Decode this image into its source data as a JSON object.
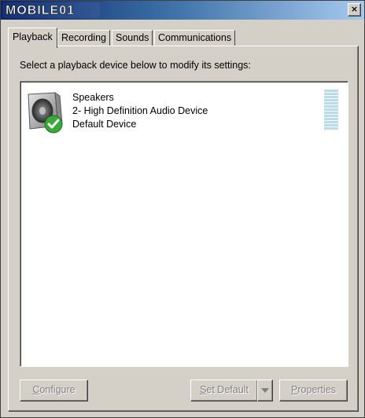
{
  "window": {
    "logo_text": "MOBILE01",
    "close_glyph": "×"
  },
  "tabs": [
    {
      "label": "Playback",
      "active": true
    },
    {
      "label": "Recording",
      "active": false
    },
    {
      "label": "Sounds",
      "active": false
    },
    {
      "label": "Communications",
      "active": false
    }
  ],
  "instructions": "Select a playback device below to modify its settings:",
  "devices": [
    {
      "name": "Speakers",
      "description": "2- High Definition Audio Device",
      "status": "Default Device",
      "icon": "speaker-icon",
      "status_icon": "checkmark-icon"
    }
  ],
  "buttons": {
    "configure": {
      "pre": "",
      "accel": "C",
      "post": "onfigure"
    },
    "set_default": {
      "pre": "",
      "accel": "S",
      "post": "et Default"
    },
    "properties": {
      "pre": "",
      "accel": "P",
      "post": "roperties"
    }
  },
  "colors": {
    "level_meter": "#b9dce8",
    "check_green": "#3aa83a"
  }
}
